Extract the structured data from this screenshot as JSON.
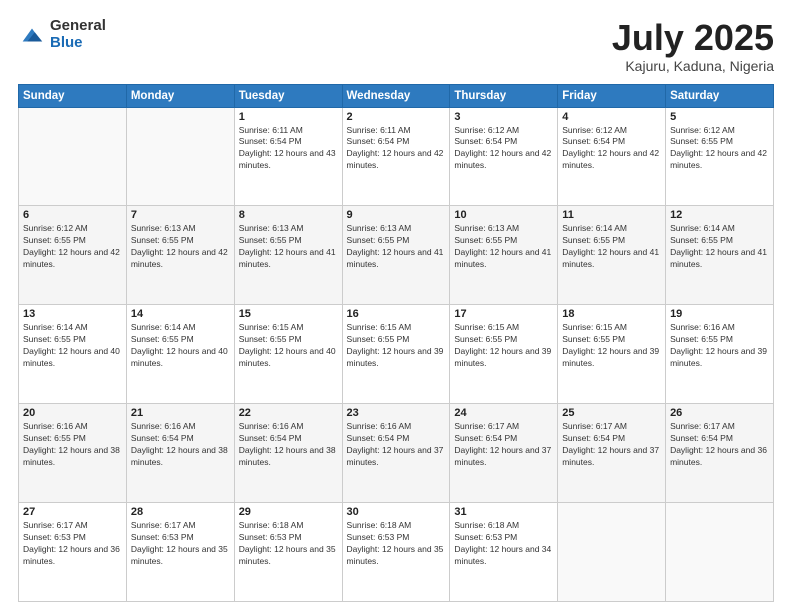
{
  "logo": {
    "general": "General",
    "blue": "Blue"
  },
  "header": {
    "title": "July 2025",
    "subtitle": "Kajuru, Kaduna, Nigeria"
  },
  "weekdays": [
    "Sunday",
    "Monday",
    "Tuesday",
    "Wednesday",
    "Thursday",
    "Friday",
    "Saturday"
  ],
  "weeks": [
    [
      {
        "day": "",
        "sunrise": "",
        "sunset": "",
        "daylight": ""
      },
      {
        "day": "",
        "sunrise": "",
        "sunset": "",
        "daylight": ""
      },
      {
        "day": "1",
        "sunrise": "Sunrise: 6:11 AM",
        "sunset": "Sunset: 6:54 PM",
        "daylight": "Daylight: 12 hours and 43 minutes."
      },
      {
        "day": "2",
        "sunrise": "Sunrise: 6:11 AM",
        "sunset": "Sunset: 6:54 PM",
        "daylight": "Daylight: 12 hours and 42 minutes."
      },
      {
        "day": "3",
        "sunrise": "Sunrise: 6:12 AM",
        "sunset": "Sunset: 6:54 PM",
        "daylight": "Daylight: 12 hours and 42 minutes."
      },
      {
        "day": "4",
        "sunrise": "Sunrise: 6:12 AM",
        "sunset": "Sunset: 6:54 PM",
        "daylight": "Daylight: 12 hours and 42 minutes."
      },
      {
        "day": "5",
        "sunrise": "Sunrise: 6:12 AM",
        "sunset": "Sunset: 6:55 PM",
        "daylight": "Daylight: 12 hours and 42 minutes."
      }
    ],
    [
      {
        "day": "6",
        "sunrise": "Sunrise: 6:12 AM",
        "sunset": "Sunset: 6:55 PM",
        "daylight": "Daylight: 12 hours and 42 minutes."
      },
      {
        "day": "7",
        "sunrise": "Sunrise: 6:13 AM",
        "sunset": "Sunset: 6:55 PM",
        "daylight": "Daylight: 12 hours and 42 minutes."
      },
      {
        "day": "8",
        "sunrise": "Sunrise: 6:13 AM",
        "sunset": "Sunset: 6:55 PM",
        "daylight": "Daylight: 12 hours and 41 minutes."
      },
      {
        "day": "9",
        "sunrise": "Sunrise: 6:13 AM",
        "sunset": "Sunset: 6:55 PM",
        "daylight": "Daylight: 12 hours and 41 minutes."
      },
      {
        "day": "10",
        "sunrise": "Sunrise: 6:13 AM",
        "sunset": "Sunset: 6:55 PM",
        "daylight": "Daylight: 12 hours and 41 minutes."
      },
      {
        "day": "11",
        "sunrise": "Sunrise: 6:14 AM",
        "sunset": "Sunset: 6:55 PM",
        "daylight": "Daylight: 12 hours and 41 minutes."
      },
      {
        "day": "12",
        "sunrise": "Sunrise: 6:14 AM",
        "sunset": "Sunset: 6:55 PM",
        "daylight": "Daylight: 12 hours and 41 minutes."
      }
    ],
    [
      {
        "day": "13",
        "sunrise": "Sunrise: 6:14 AM",
        "sunset": "Sunset: 6:55 PM",
        "daylight": "Daylight: 12 hours and 40 minutes."
      },
      {
        "day": "14",
        "sunrise": "Sunrise: 6:14 AM",
        "sunset": "Sunset: 6:55 PM",
        "daylight": "Daylight: 12 hours and 40 minutes."
      },
      {
        "day": "15",
        "sunrise": "Sunrise: 6:15 AM",
        "sunset": "Sunset: 6:55 PM",
        "daylight": "Daylight: 12 hours and 40 minutes."
      },
      {
        "day": "16",
        "sunrise": "Sunrise: 6:15 AM",
        "sunset": "Sunset: 6:55 PM",
        "daylight": "Daylight: 12 hours and 39 minutes."
      },
      {
        "day": "17",
        "sunrise": "Sunrise: 6:15 AM",
        "sunset": "Sunset: 6:55 PM",
        "daylight": "Daylight: 12 hours and 39 minutes."
      },
      {
        "day": "18",
        "sunrise": "Sunrise: 6:15 AM",
        "sunset": "Sunset: 6:55 PM",
        "daylight": "Daylight: 12 hours and 39 minutes."
      },
      {
        "day": "19",
        "sunrise": "Sunrise: 6:16 AM",
        "sunset": "Sunset: 6:55 PM",
        "daylight": "Daylight: 12 hours and 39 minutes."
      }
    ],
    [
      {
        "day": "20",
        "sunrise": "Sunrise: 6:16 AM",
        "sunset": "Sunset: 6:55 PM",
        "daylight": "Daylight: 12 hours and 38 minutes."
      },
      {
        "day": "21",
        "sunrise": "Sunrise: 6:16 AM",
        "sunset": "Sunset: 6:54 PM",
        "daylight": "Daylight: 12 hours and 38 minutes."
      },
      {
        "day": "22",
        "sunrise": "Sunrise: 6:16 AM",
        "sunset": "Sunset: 6:54 PM",
        "daylight": "Daylight: 12 hours and 38 minutes."
      },
      {
        "day": "23",
        "sunrise": "Sunrise: 6:16 AM",
        "sunset": "Sunset: 6:54 PM",
        "daylight": "Daylight: 12 hours and 37 minutes."
      },
      {
        "day": "24",
        "sunrise": "Sunrise: 6:17 AM",
        "sunset": "Sunset: 6:54 PM",
        "daylight": "Daylight: 12 hours and 37 minutes."
      },
      {
        "day": "25",
        "sunrise": "Sunrise: 6:17 AM",
        "sunset": "Sunset: 6:54 PM",
        "daylight": "Daylight: 12 hours and 37 minutes."
      },
      {
        "day": "26",
        "sunrise": "Sunrise: 6:17 AM",
        "sunset": "Sunset: 6:54 PM",
        "daylight": "Daylight: 12 hours and 36 minutes."
      }
    ],
    [
      {
        "day": "27",
        "sunrise": "Sunrise: 6:17 AM",
        "sunset": "Sunset: 6:53 PM",
        "daylight": "Daylight: 12 hours and 36 minutes."
      },
      {
        "day": "28",
        "sunrise": "Sunrise: 6:17 AM",
        "sunset": "Sunset: 6:53 PM",
        "daylight": "Daylight: 12 hours and 35 minutes."
      },
      {
        "day": "29",
        "sunrise": "Sunrise: 6:18 AM",
        "sunset": "Sunset: 6:53 PM",
        "daylight": "Daylight: 12 hours and 35 minutes."
      },
      {
        "day": "30",
        "sunrise": "Sunrise: 6:18 AM",
        "sunset": "Sunset: 6:53 PM",
        "daylight": "Daylight: 12 hours and 35 minutes."
      },
      {
        "day": "31",
        "sunrise": "Sunrise: 6:18 AM",
        "sunset": "Sunset: 6:53 PM",
        "daylight": "Daylight: 12 hours and 34 minutes."
      },
      {
        "day": "",
        "sunrise": "",
        "sunset": "",
        "daylight": ""
      },
      {
        "day": "",
        "sunrise": "",
        "sunset": "",
        "daylight": ""
      }
    ]
  ]
}
